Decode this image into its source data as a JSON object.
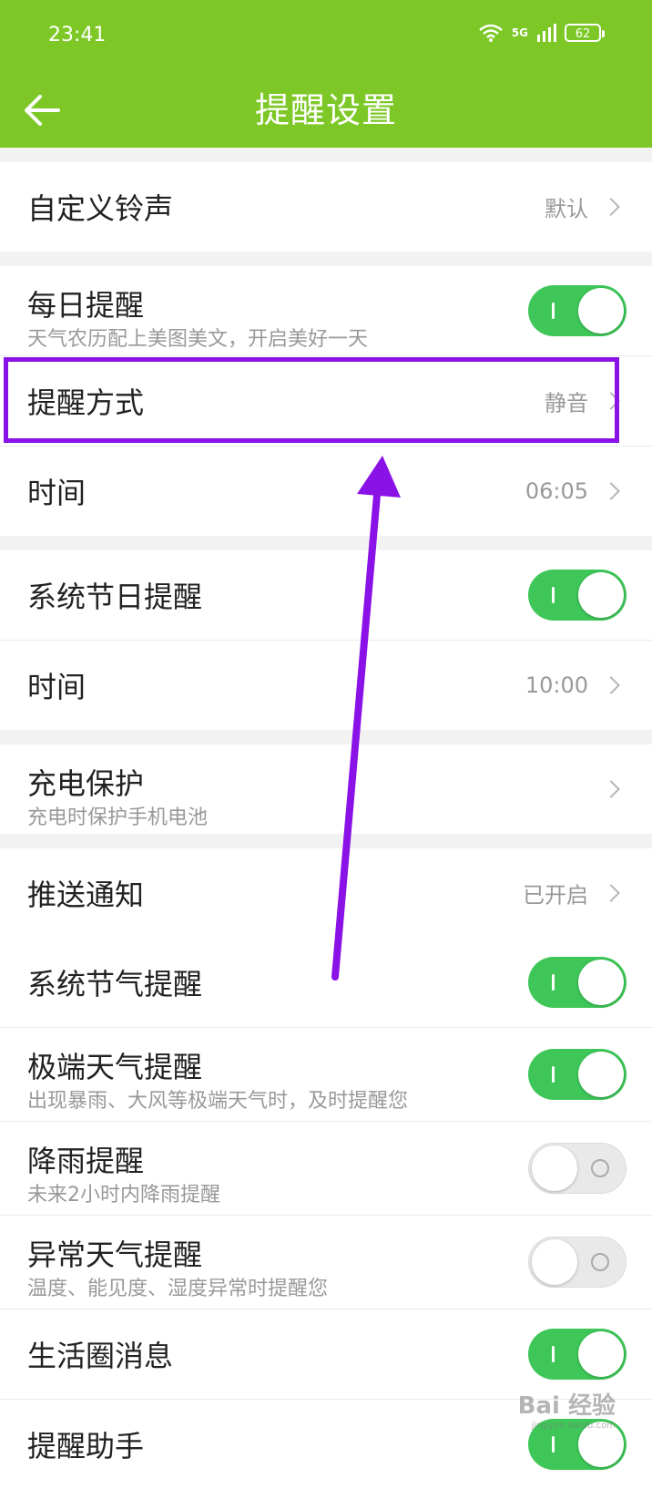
{
  "status_bar": {
    "time": "23:41",
    "network": "5G",
    "battery": "62"
  },
  "header": {
    "title": "提醒设置"
  },
  "settings": {
    "ringtone": {
      "label": "自定义铃声",
      "value": "默认"
    },
    "daily": {
      "label": "每日提醒",
      "desc": "天气农历配上美图美文，开启美好一天",
      "enabled": true
    },
    "method": {
      "label": "提醒方式",
      "value": "静音"
    },
    "daily_time": {
      "label": "时间",
      "value": "06:05"
    },
    "holiday": {
      "label": "系统节日提醒",
      "enabled": true
    },
    "holiday_time": {
      "label": "时间",
      "value": "10:00"
    },
    "charge": {
      "label": "充电保护",
      "desc": "充电时保护手机电池"
    },
    "push": {
      "label": "推送通知",
      "value": "已开启"
    },
    "solar_term": {
      "label": "系统节气提醒",
      "enabled": true
    },
    "extreme": {
      "label": "极端天气提醒",
      "desc": "出现暴雨、大风等极端天气时，及时提醒您",
      "enabled": true
    },
    "rain": {
      "label": "降雨提醒",
      "desc": "未来2小时内降雨提醒",
      "enabled": false
    },
    "abnormal": {
      "label": "异常天气提醒",
      "desc": "温度、能见度、湿度异常时提醒您",
      "enabled": false
    },
    "life": {
      "label": "生活圈消息",
      "enabled": true
    },
    "assistant": {
      "label": "提醒助手",
      "enabled": true
    }
  },
  "watermark": {
    "text": "Bai 经验",
    "sub": "jingyan.baidu.com"
  },
  "colors": {
    "header": "#7dc826",
    "toggle_on": "#3ec758",
    "annotation": "#8a12e6"
  }
}
